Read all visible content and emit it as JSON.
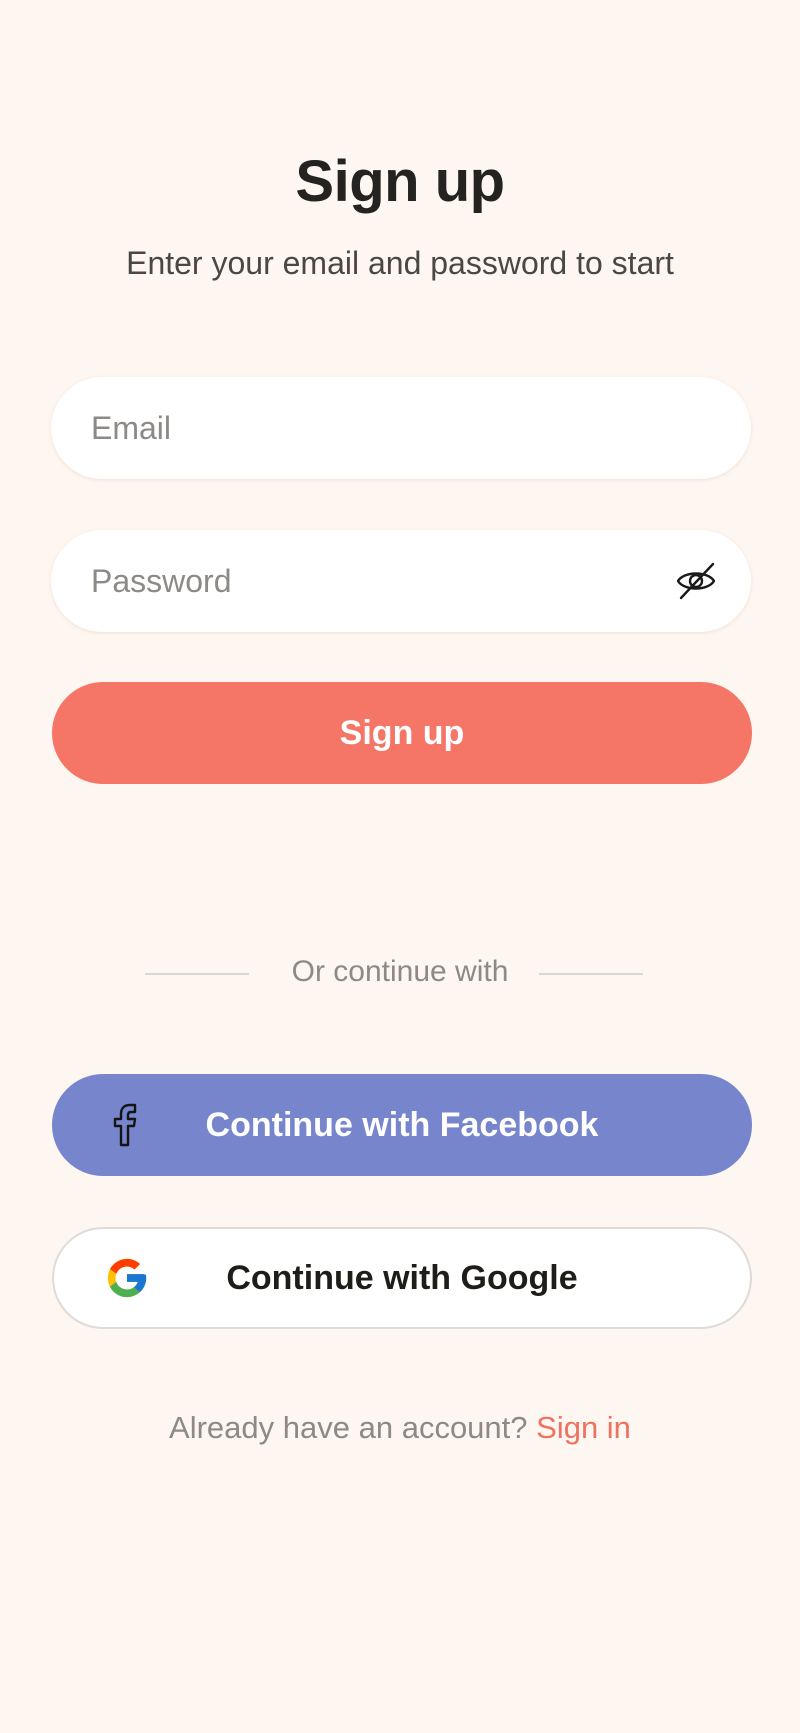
{
  "header": {
    "title": "Sign up",
    "subtitle": "Enter your email and password to start"
  },
  "form": {
    "email_placeholder": "Email",
    "email_value": "",
    "password_placeholder": "Password",
    "password_value": "",
    "password_toggle_icon": "eye-off-icon",
    "submit_label": "Sign up"
  },
  "divider": {
    "label": "Or continue with"
  },
  "social": {
    "facebook_label": "Continue with Facebook",
    "facebook_icon": "facebook-icon",
    "google_label": "Continue with Google",
    "google_icon": "google-icon"
  },
  "footer": {
    "prompt": "Already have an account?",
    "link_label": "Sign in"
  },
  "colors": {
    "background": "#FEF6F0",
    "primary": "#F57566",
    "facebook": "#7785CC",
    "link": "#EF7260"
  }
}
